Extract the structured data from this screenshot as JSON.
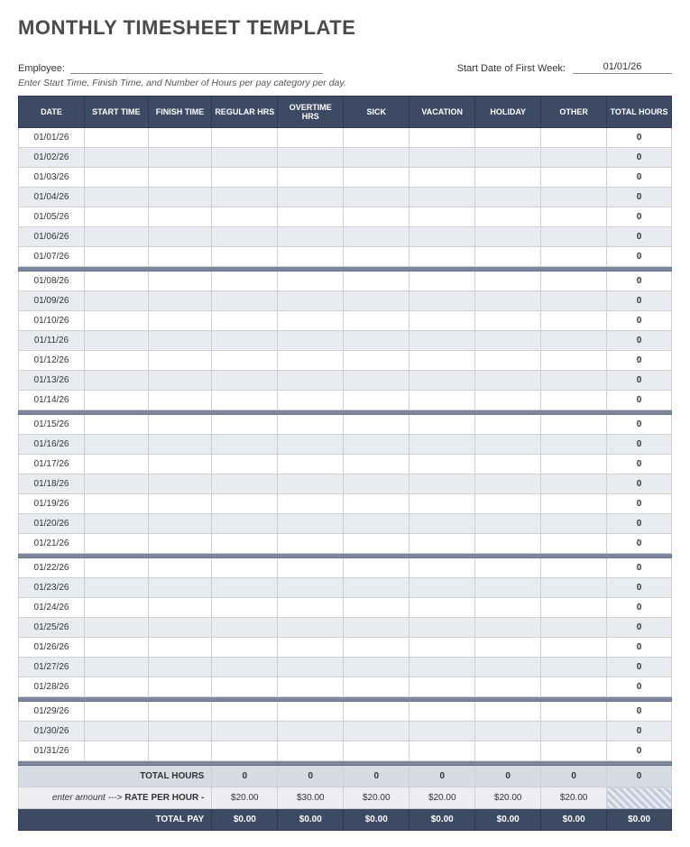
{
  "title": "MONTHLY TIMESHEET TEMPLATE",
  "meta": {
    "employee_label": "Employee:",
    "employee_value": "",
    "startdate_label": "Start Date of First Week:",
    "startdate_value": "01/01/26"
  },
  "instructions": "Enter Start Time, Finish Time, and Number of Hours per pay category per day.",
  "columns": [
    "DATE",
    "START TIME",
    "FINISH TIME",
    "REGULAR HRS",
    "OVERTIME HRS",
    "SICK",
    "VACATION",
    "HOLIDAY",
    "OTHER",
    "TOTAL HOURS"
  ],
  "weeks": [
    [
      {
        "date": "01/01/26",
        "total": "0"
      },
      {
        "date": "01/02/26",
        "total": "0"
      },
      {
        "date": "01/03/26",
        "total": "0"
      },
      {
        "date": "01/04/26",
        "total": "0"
      },
      {
        "date": "01/05/26",
        "total": "0"
      },
      {
        "date": "01/06/26",
        "total": "0"
      },
      {
        "date": "01/07/26",
        "total": "0"
      }
    ],
    [
      {
        "date": "01/08/26",
        "total": "0"
      },
      {
        "date": "01/09/26",
        "total": "0"
      },
      {
        "date": "01/10/26",
        "total": "0"
      },
      {
        "date": "01/11/26",
        "total": "0"
      },
      {
        "date": "01/12/26",
        "total": "0"
      },
      {
        "date": "01/13/26",
        "total": "0"
      },
      {
        "date": "01/14/26",
        "total": "0"
      }
    ],
    [
      {
        "date": "01/15/26",
        "total": "0"
      },
      {
        "date": "01/16/26",
        "total": "0"
      },
      {
        "date": "01/17/26",
        "total": "0"
      },
      {
        "date": "01/18/26",
        "total": "0"
      },
      {
        "date": "01/19/26",
        "total": "0"
      },
      {
        "date": "01/20/26",
        "total": "0"
      },
      {
        "date": "01/21/26",
        "total": "0"
      }
    ],
    [
      {
        "date": "01/22/26",
        "total": "0"
      },
      {
        "date": "01/23/26",
        "total": "0"
      },
      {
        "date": "01/24/26",
        "total": "0"
      },
      {
        "date": "01/25/26",
        "total": "0"
      },
      {
        "date": "01/26/26",
        "total": "0"
      },
      {
        "date": "01/27/26",
        "total": "0"
      },
      {
        "date": "01/28/26",
        "total": "0"
      }
    ],
    [
      {
        "date": "01/29/26",
        "total": "0"
      },
      {
        "date": "01/30/26",
        "total": "0"
      },
      {
        "date": "01/31/26",
        "total": "0"
      }
    ]
  ],
  "total_hours": {
    "label": "TOTAL HOURS",
    "values": [
      "0",
      "0",
      "0",
      "0",
      "0",
      "0",
      "0"
    ]
  },
  "rate": {
    "label_prefix": "enter amount --->",
    "label_bold": "RATE PER HOUR -",
    "values": [
      "$20.00",
      "$30.00",
      "$20.00",
      "$20.00",
      "$20.00",
      "$20.00"
    ]
  },
  "total_pay": {
    "label": "TOTAL PAY",
    "values": [
      "$0.00",
      "$0.00",
      "$0.00",
      "$0.00",
      "$0.00",
      "$0.00",
      "$0.00"
    ]
  }
}
